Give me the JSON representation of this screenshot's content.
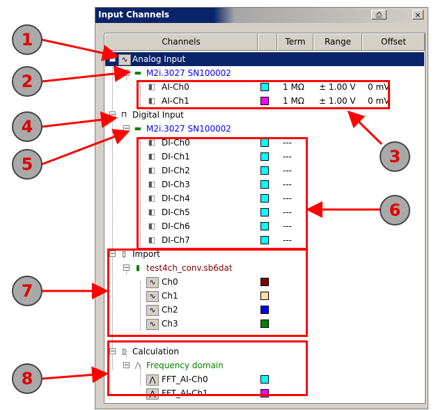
{
  "panel": {
    "title": "Input Channels",
    "print_glyph": "⎙",
    "close_glyph": "×"
  },
  "columns": {
    "channels": "Channels",
    "term": "Term",
    "range": "Range",
    "offset": "Offset"
  },
  "tree": {
    "analog": {
      "label": "Analog Input",
      "device": "M2i.3027 SN100002",
      "channels": [
        {
          "name": "AI-Ch0",
          "color": "#00ffff",
          "term": "1 MΩ",
          "range": "± 1.00 V",
          "offset": "0 mV"
        },
        {
          "name": "AI-Ch1",
          "color": "#ff00ff",
          "term": "1 MΩ",
          "range": "± 1.00 V",
          "offset": "0 mV"
        }
      ]
    },
    "digital": {
      "label": "Digital Input",
      "device": "M2i.3027 SN100002",
      "channels": [
        {
          "name": "DI-Ch0",
          "color": "#00ffff",
          "term": "---"
        },
        {
          "name": "DI-Ch1",
          "color": "#00ffff",
          "term": "---"
        },
        {
          "name": "DI-Ch2",
          "color": "#00ffff",
          "term": "---"
        },
        {
          "name": "DI-Ch3",
          "color": "#00ffff",
          "term": "---"
        },
        {
          "name": "DI-Ch4",
          "color": "#00ffff",
          "term": "---"
        },
        {
          "name": "DI-Ch5",
          "color": "#00ffff",
          "term": "---"
        },
        {
          "name": "DI-Ch6",
          "color": "#00ffff",
          "term": "---"
        },
        {
          "name": "DI-Ch7",
          "color": "#00ffff",
          "term": "---"
        }
      ]
    },
    "import": {
      "label": "Import",
      "file": "test4ch_conv.sb6dat",
      "channels": [
        {
          "name": "Ch0",
          "color": "#800000"
        },
        {
          "name": "Ch1",
          "color": "#ffe0a0"
        },
        {
          "name": "Ch2",
          "color": "#0000ff"
        },
        {
          "name": "Ch3",
          "color": "#008000"
        }
      ]
    },
    "calculation": {
      "label": "Calculation",
      "group": "Frequency domain",
      "channels": [
        {
          "name": "FFT_AI-Ch0",
          "color": "#00ffff"
        },
        {
          "name": "FFT_AI-Ch1",
          "color": "#ff00ff"
        }
      ]
    }
  },
  "annotations": [
    "1",
    "2",
    "3",
    "4",
    "5",
    "6",
    "7",
    "8"
  ],
  "colors": {
    "highlight": "#ff0000",
    "selection": "#0a246a",
    "marker_bg": "#a9a9a9"
  }
}
